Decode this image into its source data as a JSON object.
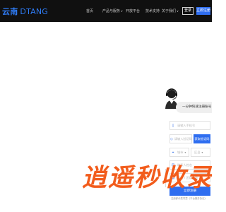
{
  "logo": {
    "text_cn": "云南",
    "text_en": "DTANG"
  },
  "nav": {
    "items": [
      {
        "label": "首页",
        "has_dropdown": false
      },
      {
        "label": "产品与服务",
        "has_dropdown": true
      },
      {
        "label": "开放平台",
        "has_dropdown": false
      },
      {
        "label": "技术支持",
        "has_dropdown": false
      },
      {
        "label": "关于我们",
        "has_dropdown": true
      }
    ],
    "dropdown_glyph": "∨",
    "login_label": "登录",
    "register_label": "立即注册"
  },
  "form": {
    "promo_text": "一分钟快速注册账号",
    "phone_placeholder": "请输入手机号",
    "sms_code_placeholder": "请输入验证码",
    "get_code_label": "获取验证码",
    "city_placeholder": "城市",
    "district_placeholder": "区县",
    "contact_placeholder": "联系人姓名",
    "company_placeholder": "公司 / 团队名称",
    "submit_label": "立即注册",
    "agreement_note": "注册即代表同意《平台服务协议》"
  },
  "slogan": "逍遥秒收录",
  "colors": {
    "navbar_bg": "#101010",
    "brand_blue": "#2f6ef0",
    "slogan_orange": "#f25c1c",
    "page_bg": "#ffffff"
  },
  "icons": {
    "agent": "customer-service-agent-icon",
    "phone": "phone-icon",
    "shield": "shield-icon",
    "location": "location-icon",
    "user": "user-icon",
    "building": "building-icon"
  }
}
